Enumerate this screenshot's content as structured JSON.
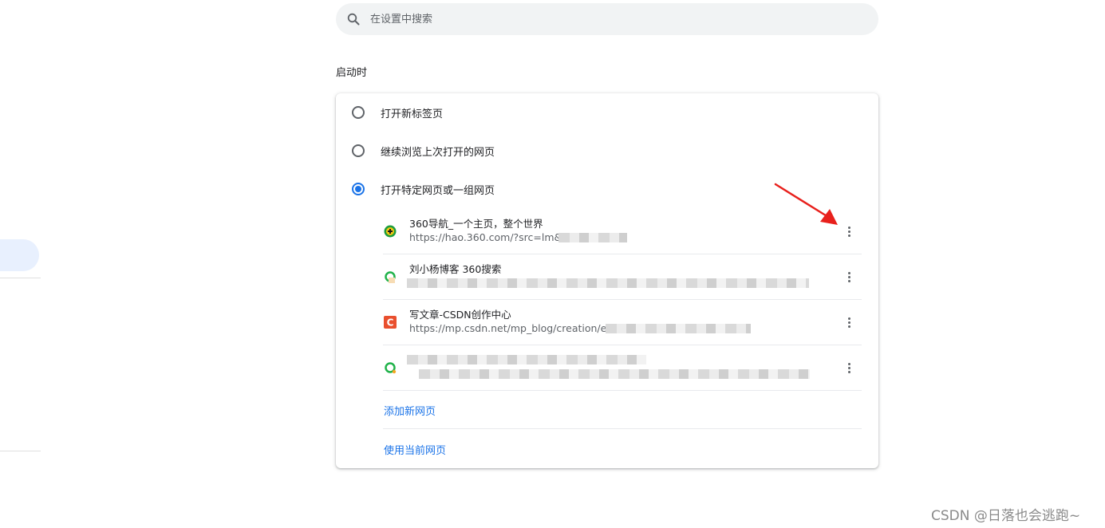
{
  "search": {
    "placeholder": "在设置中搜索",
    "icon": "search-icon"
  },
  "startup": {
    "title": "启动时",
    "options": [
      {
        "label": "打开新标签页",
        "checked": false
      },
      {
        "label": "继续浏览上次打开的网页",
        "checked": false
      },
      {
        "label": "打开特定网页或一组网页",
        "checked": true
      }
    ],
    "pages": [
      {
        "title": "360导航_一个主页，整个世界",
        "url": "https://hao.360.com/?src=lm&ls",
        "icon": "360-nav-favicon"
      },
      {
        "title": "刘小杨博客 360搜索",
        "url": "",
        "icon": "360-search-favicon"
      },
      {
        "title": "写文章-CSDN创作中心",
        "url": "https://mp.csdn.net/mp_blog/creation/edit",
        "icon": "csdn-favicon"
      },
      {
        "title": "",
        "url": "",
        "icon": "360-search-favicon"
      }
    ],
    "add_page": "添加新网页",
    "use_current": "使用当前网页"
  },
  "colors": {
    "accent": "#1a73e8",
    "annotation_arrow": "#e8201c"
  },
  "watermark": "CSDN @日落也会逃跑~"
}
